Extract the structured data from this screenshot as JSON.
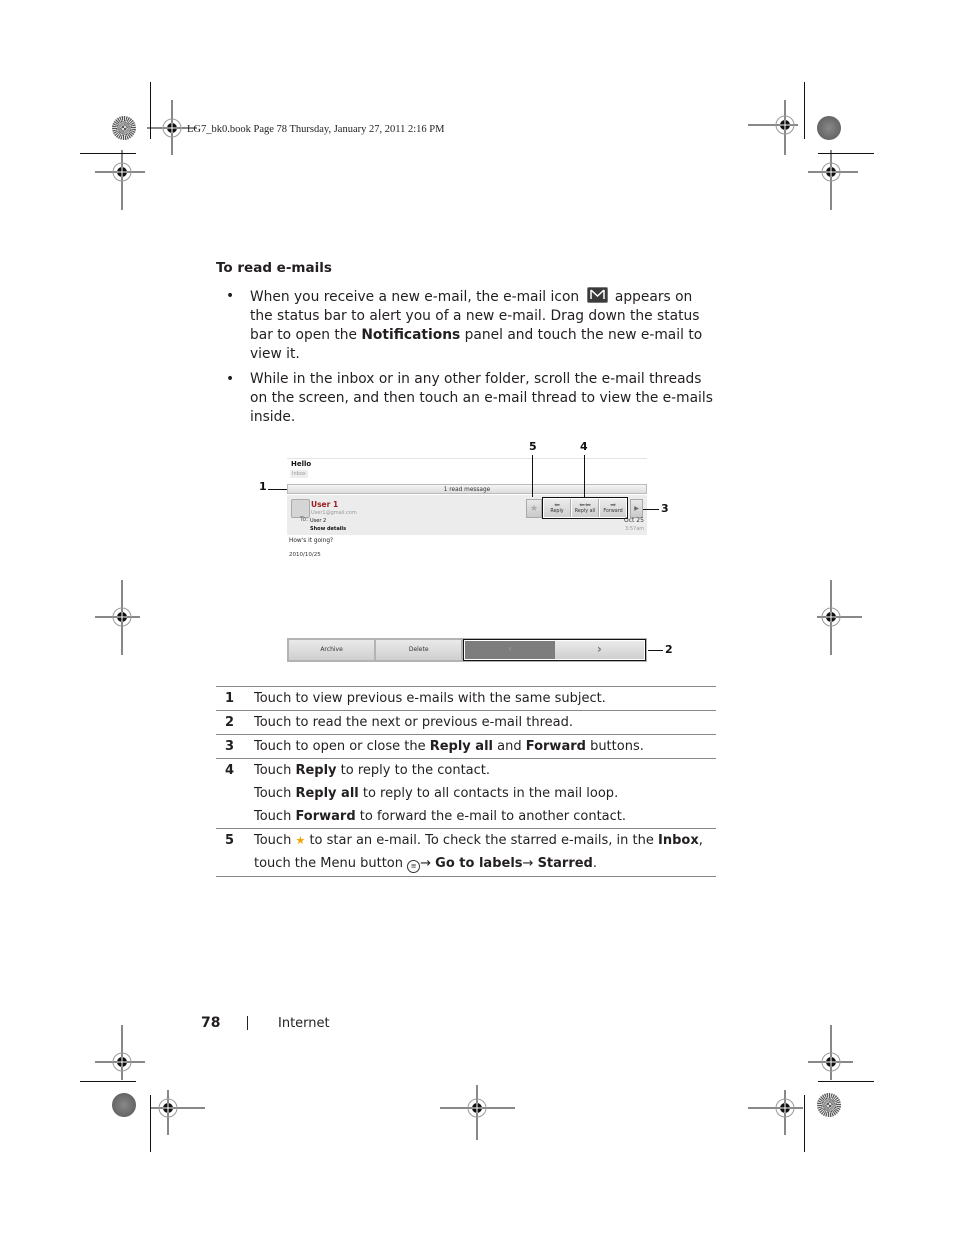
{
  "slug": "LG7_bk0.book  Page 78  Thursday, January 27, 2011  2:16 PM",
  "heading": "To read e-mails",
  "bullets": [
    {
      "part1": "When you receive a new e-mail, the e-mail icon",
      "icon": "email-notification-icon",
      "part2": "appears on the status bar to alert you of a new e-mail. Drag down the status bar to open the",
      "bold": "Notifications",
      "part3": "panel and touch the new e-mail to view it."
    },
    {
      "text": "While in the inbox or in any other folder, scroll the e-mail threads on the screen, and then touch an e-mail thread to view the e-mails inside."
    }
  ],
  "screenshot": {
    "subject": "Hello",
    "label": "Inbox",
    "read_message": "1 read message",
    "sender_name": "User 1",
    "sender_email": "User1@gmail.com",
    "to_label": "To:",
    "to_value": "User 2",
    "show_details": "Show details",
    "actions": [
      "Reply",
      "Reply all",
      "Forward"
    ],
    "date": "Oct 25",
    "time": "3:57am",
    "body": "How's it going?",
    "body_date": "2010/10/25",
    "bottom_buttons": [
      "Archive",
      "Delete"
    ],
    "nav_prev": "‹",
    "nav_next": "›"
  },
  "callouts": [
    "1",
    "2",
    "3",
    "4",
    "5"
  ],
  "table": [
    {
      "num": "1",
      "text": "Touch to view previous e-mails with the same subject."
    },
    {
      "num": "2",
      "text": "Touch to read the next or previous e-mail thread."
    },
    {
      "num": "3",
      "pre": "Touch to open or close the ",
      "b1": "Reply all",
      "mid": " and ",
      "b2": "Forward",
      "post": " buttons."
    },
    {
      "num": "4",
      "lines": [
        {
          "pre": "Touch ",
          "b": "Reply",
          "post": " to reply to the contact."
        },
        {
          "pre": "Touch ",
          "b": "Reply all",
          "post": " to reply to all contacts in the mail loop."
        },
        {
          "pre": "Touch ",
          "b": "Forward",
          "post": " to forward the e-mail to another contact."
        }
      ]
    },
    {
      "num": "5",
      "pre": "Touch ",
      "mid": " to star an e-mail. To check the starred e-mails, in the ",
      "b1": "Inbox",
      "line2pre": "touch the Menu button ",
      "arrow": "→",
      "b2": "Go to labels",
      "b3": "Starred"
    }
  ],
  "footer": {
    "page_number": "78",
    "section": "Internet"
  }
}
